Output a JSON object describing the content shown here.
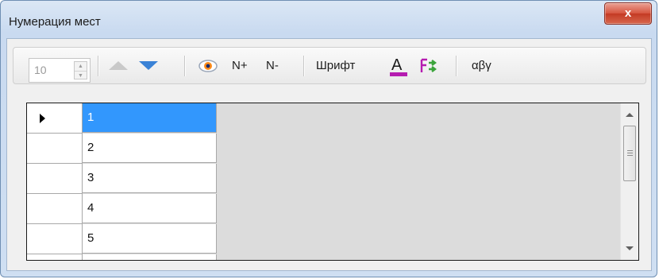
{
  "window": {
    "title": "Нумерация мест",
    "close_label": "x"
  },
  "toolbar": {
    "spin_value": "10",
    "n_plus": "N+",
    "n_minus": "N-",
    "font_label": "Шрифт",
    "color_a": "A",
    "greek": "αβγ"
  },
  "icons": [
    "spin-up-arrow",
    "spin-down-arrow",
    "move-up-icon",
    "move-down-icon",
    "eye-icon",
    "font-color-icon",
    "font-swap-icon",
    "row-pointer-icon"
  ],
  "colors": {
    "selection": "#3297fd",
    "accent_blue": "#3a82d6",
    "close_red": "#c33b24"
  },
  "grid": {
    "rows": [
      {
        "value": "1",
        "selected": true
      },
      {
        "value": "2"
      },
      {
        "value": "3"
      },
      {
        "value": "4"
      },
      {
        "value": "5"
      },
      {
        "value": ""
      }
    ]
  }
}
